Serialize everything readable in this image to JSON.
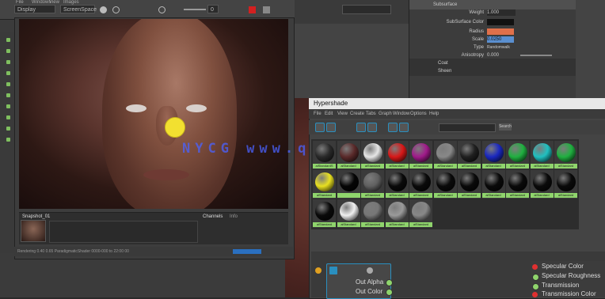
{
  "top_menu": [
    "File",
    "Windows",
    "View",
    "Images"
  ],
  "toolbar": {
    "left_dropdown": "Display",
    "center_dropdown": "ScreenSpace",
    "frame_field": "0"
  },
  "render_view": {
    "bottom_left_tab": "Snapshot_01",
    "bottom_tab_a": "Channels",
    "bottom_tab_b": "Info",
    "status_text": "Rendering 0.40 0.65 ParadigmaticShader 0000-000 to 22:00 00"
  },
  "watermark": "NYCG www.qqnxxia.com",
  "attribute_editor": {
    "section": "Subsurface",
    "weight_label": "Weight",
    "weight_value": "1.000",
    "subsurface_color_label": "SubSurface Color",
    "subsurface_color": "#111111",
    "radius_label": "Radius",
    "radius_color": "#e0704a",
    "scale_label": "Scale",
    "scale_value": "0.0250",
    "type_label": "Type",
    "type_value": "Randomwalk",
    "anisotropy_label": "Anisotropy",
    "anisotropy_value": "0.000",
    "coat_label": "Coat",
    "sheen_label": "Sheen"
  },
  "hypershade": {
    "title": "Hypershade",
    "menu": [
      "File",
      "Edit",
      "View",
      "Create",
      "Tabs",
      "Graph",
      "Window",
      "Options",
      "Help"
    ],
    "filter_value": "",
    "search_button": "Search"
  },
  "materials": [
    {
      "name": "aiStandardS",
      "color": "#2a2a2a"
    },
    {
      "name": "aiStandard",
      "color": "#5a2a2a"
    },
    {
      "name": "aiStandard",
      "color": "#e6e6e6"
    },
    {
      "name": "aiStandard",
      "color": "#d81818"
    },
    {
      "name": "aiStandard",
      "color": "#a01a8a"
    },
    {
      "name": "aiStandard",
      "color": "#888888"
    },
    {
      "name": "aiStandard",
      "color": "#202020"
    },
    {
      "name": "aiStandard",
      "color": "#1a28c0"
    },
    {
      "name": "aiStandard",
      "color": "#20b040"
    },
    {
      "name": "aiStandard",
      "color": "#20c0c0"
    },
    {
      "name": "aiStandard",
      "color": "#20b040"
    },
    {
      "name": "aiStandard",
      "color": "#e8e020"
    },
    {
      "name": "",
      "color": "#050505"
    },
    {
      "name": "aiStandard",
      "color": "#606060"
    },
    {
      "name": "aiStandard",
      "color": "#0a0a0a"
    },
    {
      "name": "aiStandard",
      "color": "#0a0a0a"
    },
    {
      "name": "aiStandard",
      "color": "#0a0a0a"
    },
    {
      "name": "aiStandard",
      "color": "#0a0a0a"
    },
    {
      "name": "aiStandard",
      "color": "#0a0a0a"
    },
    {
      "name": "aiStandard",
      "color": "#0a0a0a"
    },
    {
      "name": "aiStandard",
      "color": "#0a0a0a"
    },
    {
      "name": "aiStandard",
      "color": "#0a0a0a"
    },
    {
      "name": "aiStandard",
      "color": "#0a0a0a"
    },
    {
      "name": "aiStandard",
      "color": "#f0f0f0"
    },
    {
      "name": "aiStandard",
      "color": "#777777"
    },
    {
      "name": "aiStandard",
      "color": "#9a9a9a"
    },
    {
      "name": "aiStandard",
      "color": "#888888"
    }
  ],
  "node_editor": {
    "node_ports": [
      "Out Alpha",
      "Out Color"
    ],
    "right_ports": [
      "Specular Color",
      "Specular Roughness",
      "Transmission",
      "Transmission Color"
    ]
  }
}
